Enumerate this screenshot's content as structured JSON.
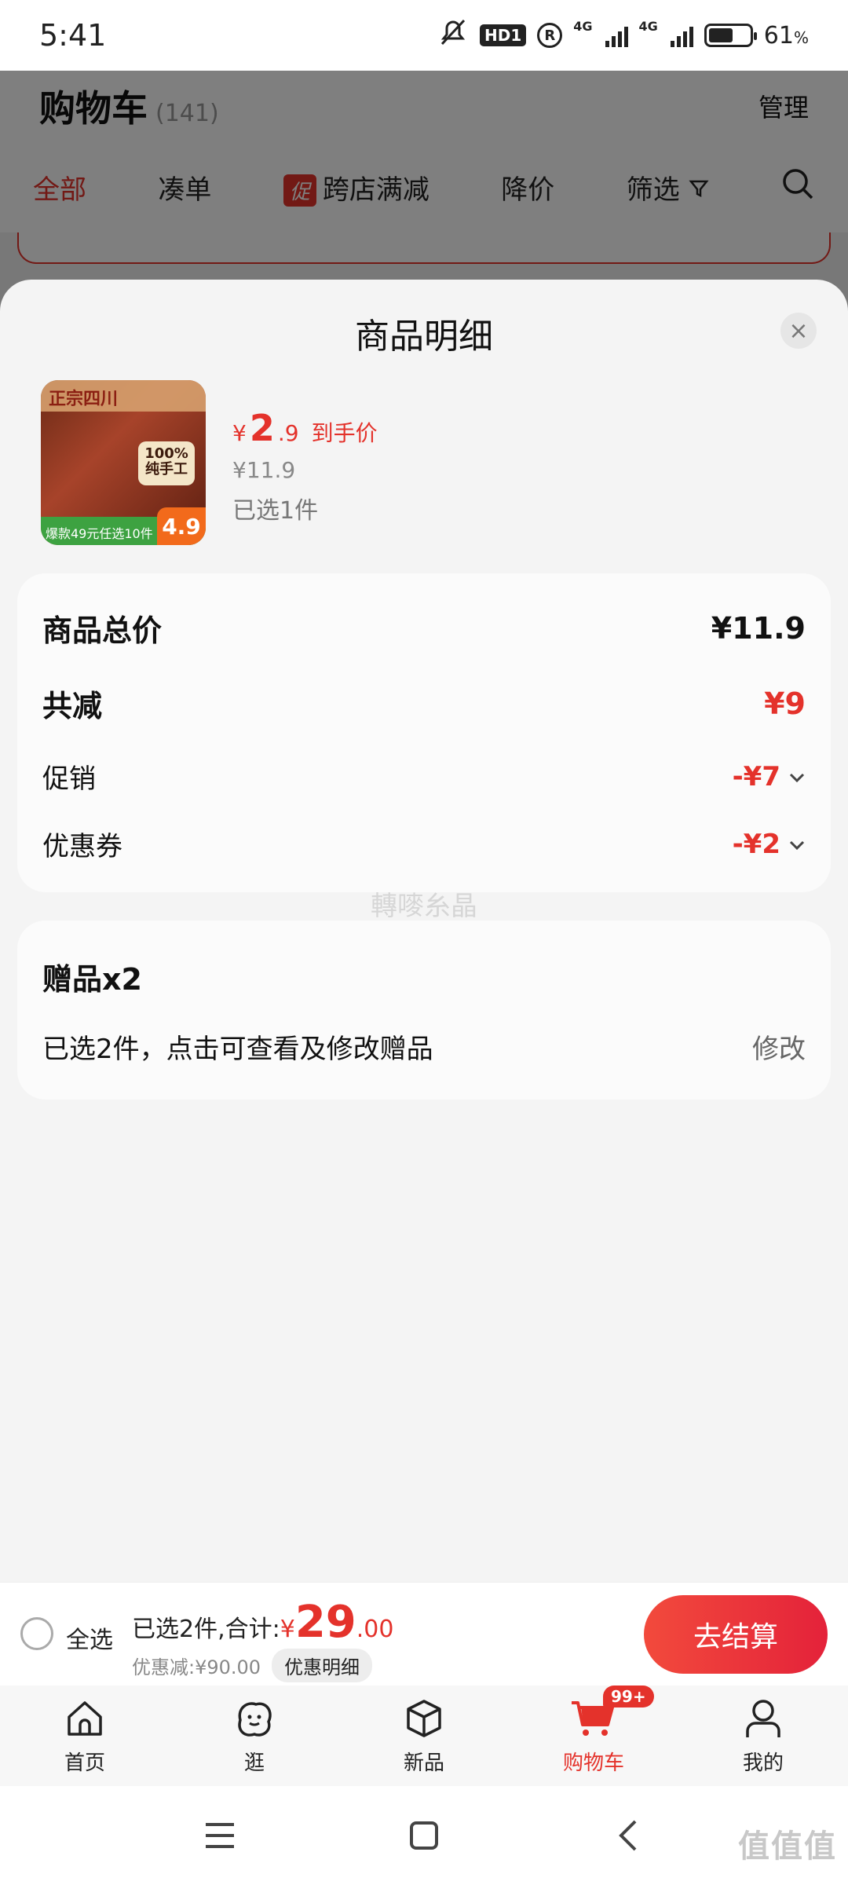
{
  "status_bar": {
    "time": "5:41",
    "hd_label": "HD1",
    "r_label": "R",
    "net1": "4G",
    "net2": "4G",
    "battery_percent": "61",
    "battery_unit": "%",
    "battery_level": 0.61
  },
  "background_page": {
    "title": "购物车",
    "count": "(141)",
    "manage_label": "管理",
    "tabs": [
      {
        "label": "全部",
        "active": true
      },
      {
        "label": "凑单"
      },
      {
        "label": "跨店满减",
        "tag": "促"
      },
      {
        "label": "降价"
      },
      {
        "label": "筛选"
      }
    ]
  },
  "sheet": {
    "title": "商品明细",
    "close_label": "×",
    "product": {
      "image_banner": "正宗四川",
      "image_badge": "100%纯手工",
      "image_promo": "爆款49元任选10件",
      "image_price": "4.9",
      "price_yen": "¥",
      "price_int": "2",
      "price_dec": ".9",
      "price_label": "到手价",
      "original_price": "¥11.9",
      "selected": "已选1件"
    },
    "summary": {
      "total_label": "商品总价",
      "total_value": "¥11.9",
      "reduce_label": "共减",
      "reduce_value": "¥9",
      "promo_label": "促销",
      "promo_value": "-¥7",
      "coupon_label": "优惠券",
      "coupon_value": "-¥2"
    },
    "gift": {
      "title": "赠品x2",
      "desc": "已选2件，点击可查看及修改赠品",
      "edit_label": "修改"
    },
    "watermark": "轉嘜糸晶"
  },
  "checkout": {
    "select_all": "全选",
    "total_prefix": "已选2件,合计:",
    "total_yen": "¥",
    "total_int": "29",
    "total_dec": ".00",
    "discount": "优惠减:¥90.00",
    "detail_label": "优惠明细",
    "button_label": "去结算"
  },
  "tabbar": {
    "tabs": [
      {
        "label": "首页",
        "icon": "home-icon"
      },
      {
        "label": "逛",
        "icon": "face-icon"
      },
      {
        "label": "新品",
        "icon": "box-icon"
      },
      {
        "label": "购物车",
        "icon": "cart-icon",
        "badge": "99+",
        "active": true
      },
      {
        "label": "我的",
        "icon": "user-icon"
      }
    ]
  },
  "corner_mark": "值值值",
  "colors": {
    "accent": "#e4322b",
    "checkout_gradient_start": "#f24a3c",
    "checkout_gradient_end": "#e4223a"
  }
}
